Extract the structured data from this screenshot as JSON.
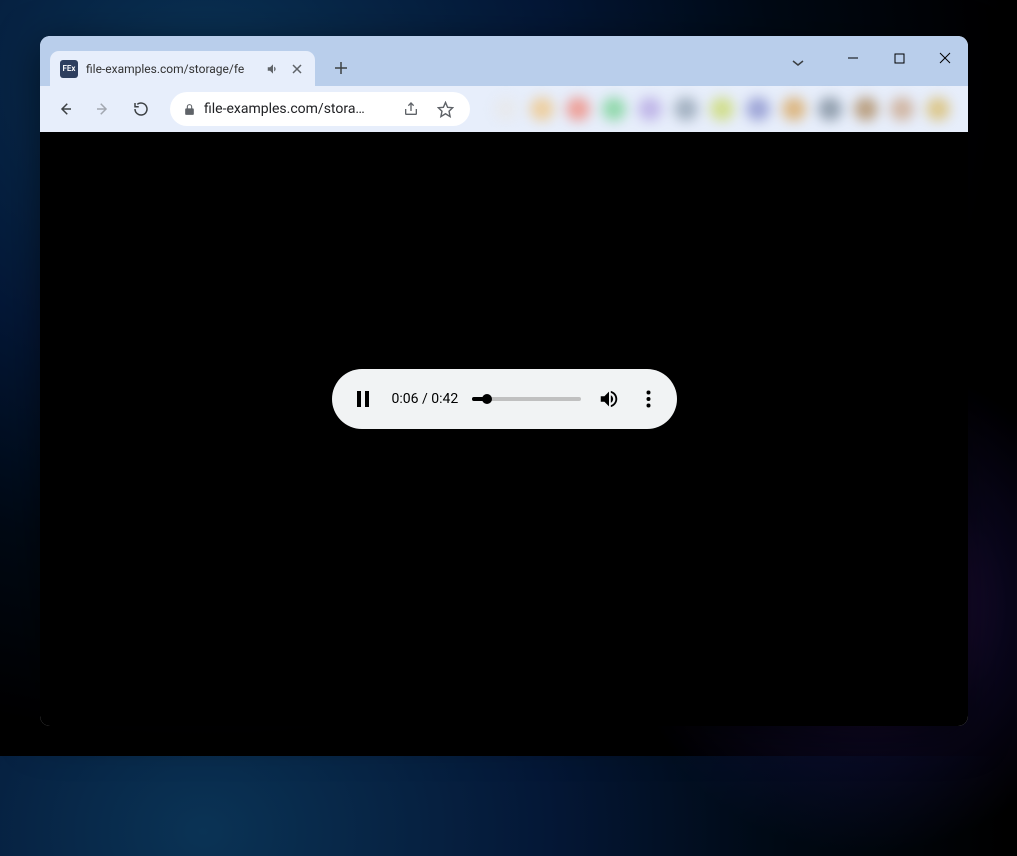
{
  "tab": {
    "favicon_text": "FEx",
    "title": "file-examples.com/storage/fe",
    "audio_playing": true
  },
  "addressbar": {
    "url_display": "file-examples.com/stora…"
  },
  "player": {
    "current_time": "0:06",
    "total_time": "0:42",
    "time_display": "0:06 / 0:42",
    "progress_percent": 14,
    "state": "playing"
  },
  "extension_colors": [
    "#e8e8e8",
    "#f0c27b",
    "#f08070",
    "#6fd08c",
    "#b0a0e0",
    "#8899aa",
    "#c8d860",
    "#8088c8",
    "#d8a050",
    "#708090",
    "#a88050",
    "#c8a080",
    "#d8b860"
  ]
}
